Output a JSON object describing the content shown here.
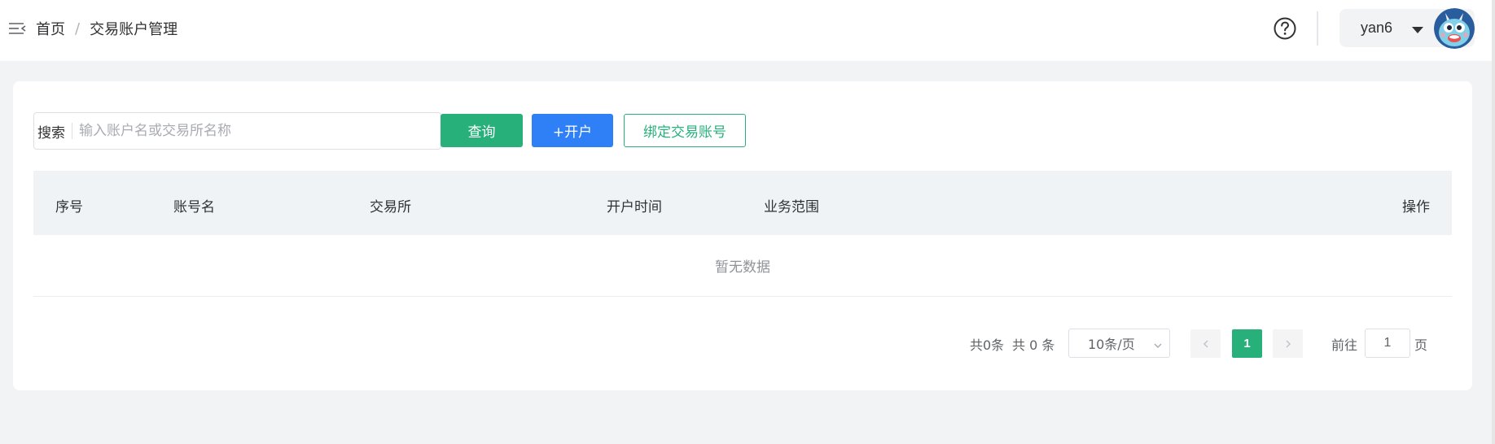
{
  "header": {
    "breadcrumb": {
      "home": "首页",
      "separator": "/",
      "current": "交易账户管理"
    },
    "user": {
      "name": "yan6"
    }
  },
  "search": {
    "label": "搜索",
    "placeholder": "输入账户名或交易所名称",
    "value": ""
  },
  "buttons": {
    "query": "查询",
    "open_account": "+开户",
    "bind_account": "绑定交易账号"
  },
  "table": {
    "columns": [
      "序号",
      "账号名",
      "交易所",
      "开户时间",
      "业务范围",
      "操作"
    ],
    "rows": [],
    "empty_text": "暂无数据"
  },
  "pagination": {
    "total_short": "共0条",
    "total_long": "共 0 条",
    "page_size": "10条/页",
    "current_page": "1",
    "goto_label": "前往",
    "goto_value": "1",
    "page_suffix": "页"
  },
  "colors": {
    "primary_green": "#28b07a",
    "primary_blue": "#2f80f7",
    "header_bg": "#f0f3f5",
    "page_bg": "#f2f3f4"
  }
}
